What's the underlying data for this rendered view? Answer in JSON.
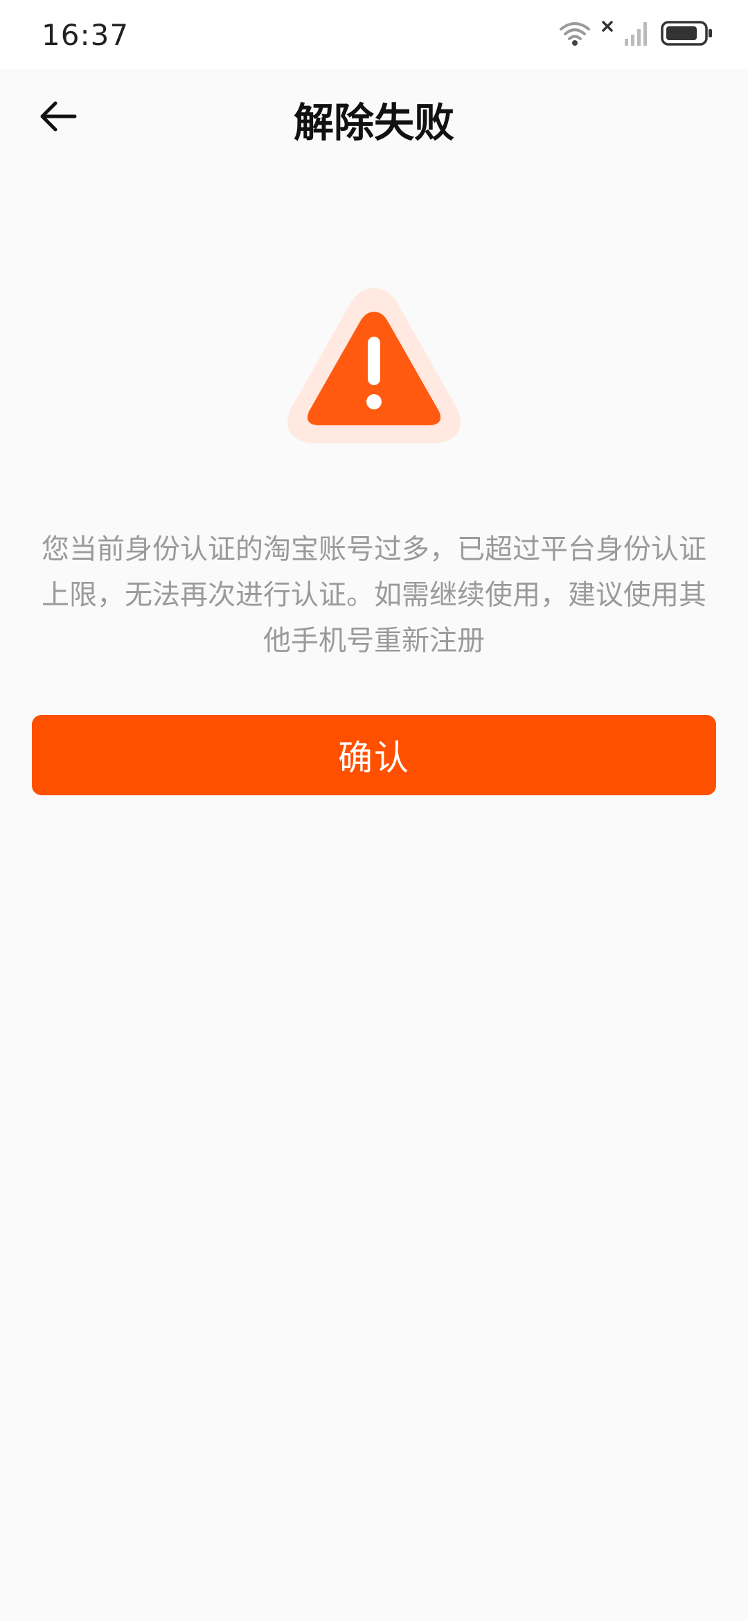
{
  "status_bar": {
    "time": "16:37",
    "icons": [
      "wifi-icon",
      "no-signal-icon",
      "cellular-signal-icon",
      "battery-icon"
    ]
  },
  "nav": {
    "back_icon": "back-arrow-icon",
    "title": "解除失败"
  },
  "content": {
    "icon": "warning-triangle-icon",
    "message": "您当前身份认证的淘宝账号过多，已超过平台身份认证上限，无法再次进行认证。如需继续使用，建议使用其他手机号重新注册"
  },
  "actions": {
    "confirm_label": "确认"
  },
  "colors": {
    "accent": "#ff5000",
    "icon_halo": "#ffe9e0",
    "message_text": "#9a9a9a",
    "background": "#fafafa"
  }
}
